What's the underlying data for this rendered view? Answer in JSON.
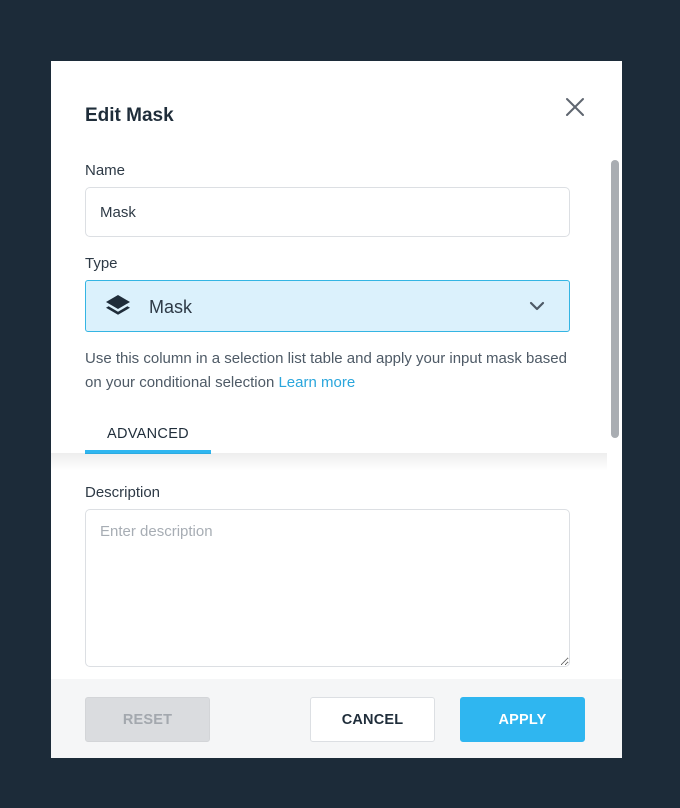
{
  "dialog": {
    "title": "Edit Mask",
    "close_icon": "close-icon"
  },
  "name_field": {
    "label": "Name",
    "value": "Mask"
  },
  "type_field": {
    "label": "Type",
    "value": "Mask",
    "icon": "layers-icon",
    "dropdown_icon": "chevron-down-icon"
  },
  "helper": {
    "text": "Use this column in a selection list table and apply your input mask based on your conditional selection ",
    "link": "Learn more"
  },
  "tabs": [
    {
      "label": "ADVANCED",
      "active": true
    }
  ],
  "description_field": {
    "label": "Description",
    "placeholder": "Enter description",
    "value": ""
  },
  "footer": {
    "reset_label": "RESET",
    "cancel_label": "CANCEL",
    "apply_label": "APPLY"
  },
  "colors": {
    "backdrop": "#1c2b39",
    "accent": "#2fb6f0",
    "select_bg": "#dbf1fc",
    "link": "#2aa6dc"
  }
}
